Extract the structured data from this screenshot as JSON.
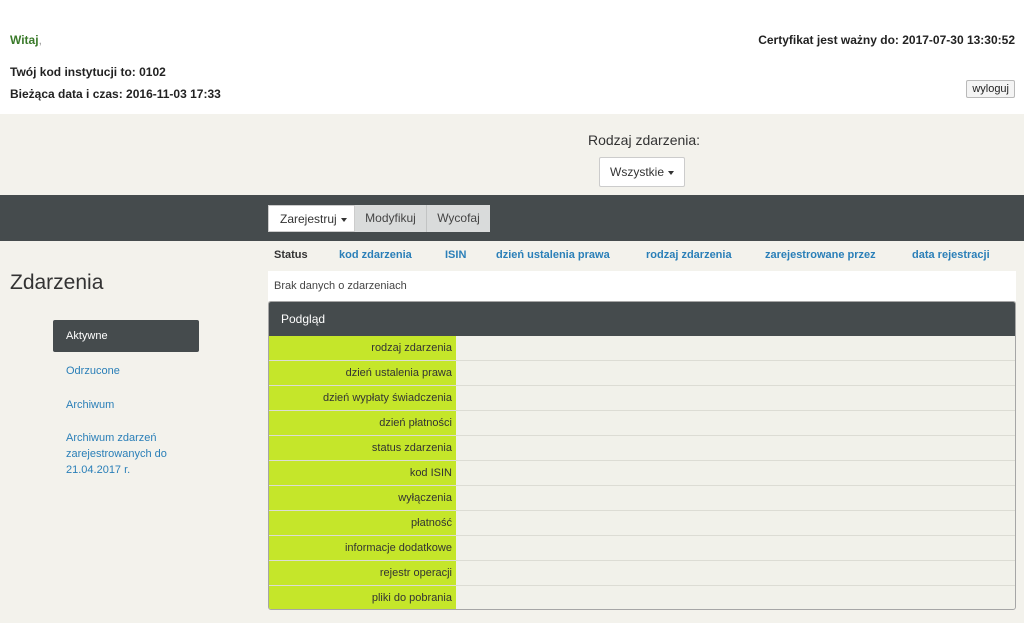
{
  "header": {
    "welcome": "Witaj",
    "welcome_punct": ",",
    "institution_code": "Twój kod instytucji to: 0102",
    "current_datetime": "Bieżąca data i czas: 2016-11-03 17:33",
    "certificate": "Certyfikat jest ważny do: 2017-07-30 13:30:52",
    "logout_label": "wyloguj"
  },
  "filter": {
    "label": "Rodzaj zdarzenia:",
    "selected": "Wszystkie"
  },
  "toolbar": {
    "register": "Zarejestruj",
    "modify": "Modyfikuj",
    "withdraw": "Wycofaj"
  },
  "sidebar": {
    "title": "Zdarzenia",
    "items": [
      {
        "label": "Aktywne",
        "active": true
      },
      {
        "label": "Odrzucone"
      },
      {
        "label": "Archiwum"
      },
      {
        "label": "Archiwum zdarzeń zarejestrowanych do 21.04.2017 r."
      }
    ]
  },
  "table": {
    "columns": [
      "Status",
      "kod zdarzenia",
      "ISIN",
      "dzień ustalenia prawa",
      "rodzaj zdarzenia",
      "zarejestrowane przez",
      "data rejestracji"
    ],
    "empty_message": "Brak danych o zdarzeniach"
  },
  "preview": {
    "title": "Podgląd",
    "fields": [
      "rodzaj zdarzenia",
      "dzień ustalenia prawa",
      "dzień wypłaty świadczenia",
      "dzień płatności",
      "status zdarzenia",
      "kod ISIN",
      "wyłączenia",
      "płatność",
      "informacje dodatkowe",
      "rejestr operacji",
      "pliki do pobrania"
    ]
  },
  "colors": {
    "dark_bar": "#454b4d",
    "label_green": "#c5e62a",
    "link_blue": "#2a7fb8",
    "welcome_green": "#3a7a2a"
  }
}
